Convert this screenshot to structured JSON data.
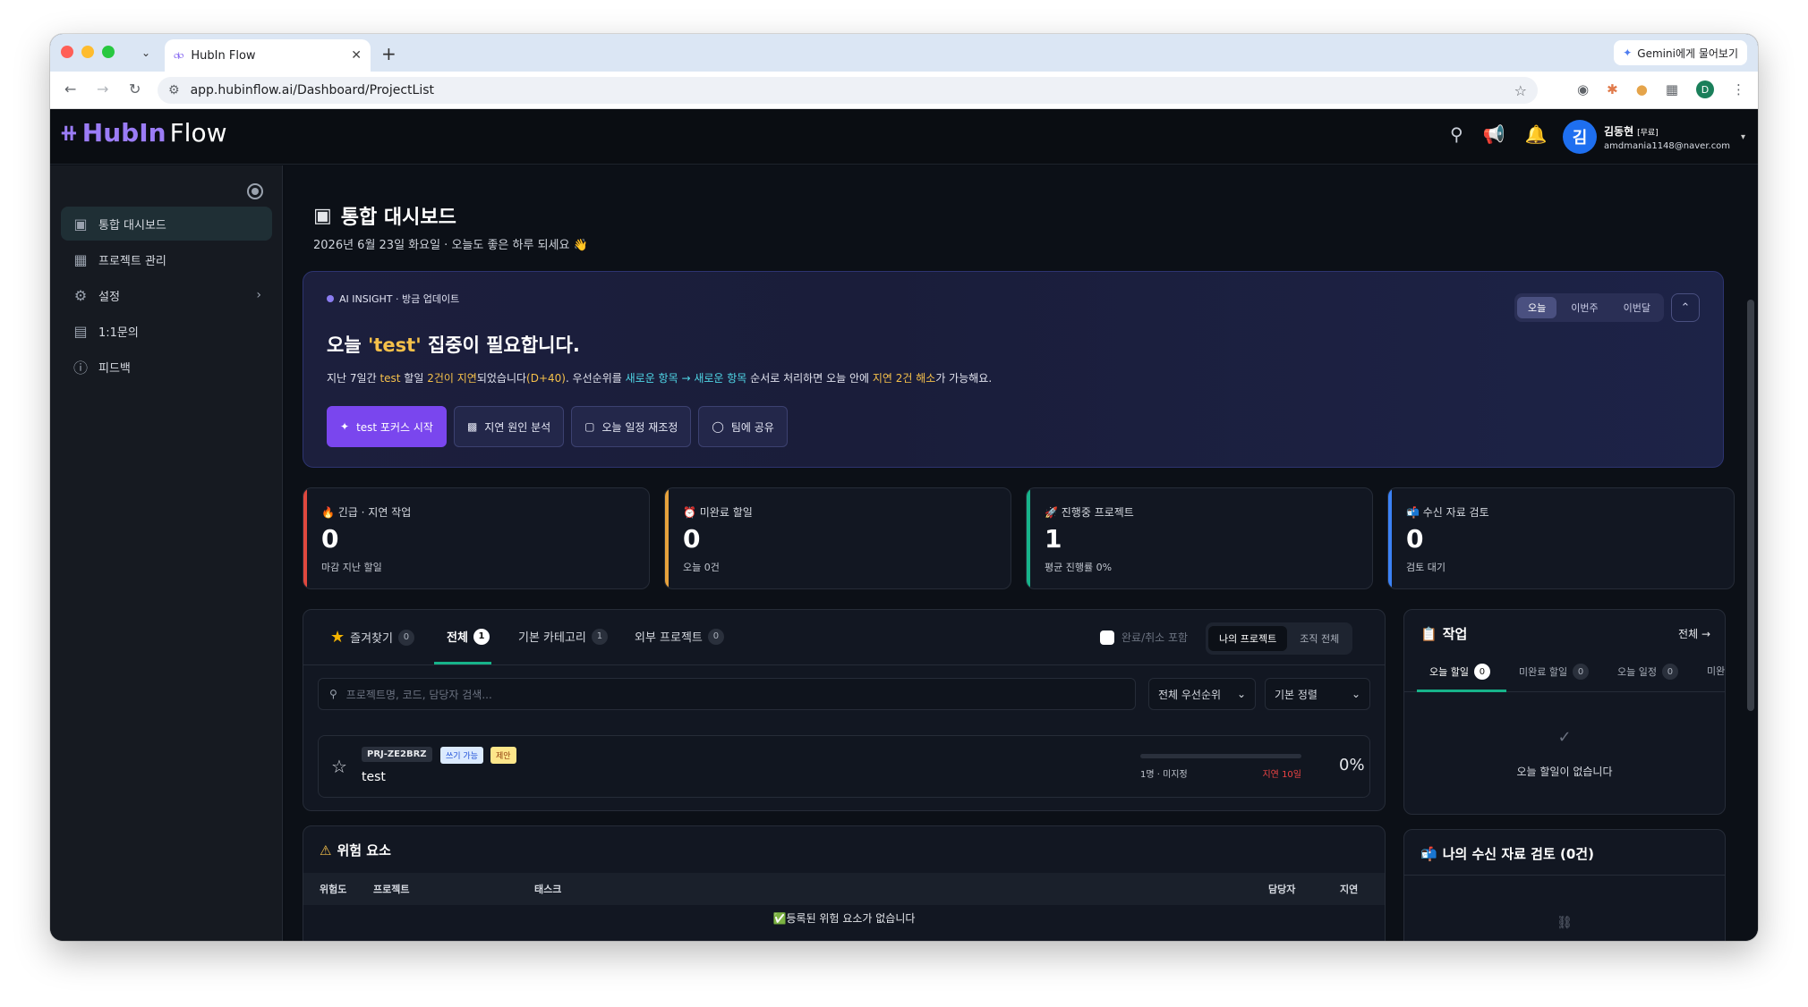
{
  "browser": {
    "tab_title": "HubIn Flow",
    "url": "app.hubinflow.ai/Dashboard/ProjectList",
    "gemini_label": "Gemini에게 물어보기",
    "profile_initial": "D"
  },
  "header": {
    "logo_hub": "HubIn",
    "logo_flow": "Flow",
    "user_initial": "김",
    "user_name": "김동현",
    "user_plan": "[무료]",
    "user_email": "amdmania1148@naver.com"
  },
  "sidebar": {
    "items": [
      {
        "label": "통합 대시보드",
        "icon": "dashboard-icon"
      },
      {
        "label": "프로젝트 관리",
        "icon": "kanban-icon"
      },
      {
        "label": "설정",
        "icon": "gear-icon"
      },
      {
        "label": "1:1문의",
        "icon": "chat-icon"
      },
      {
        "label": "피드백",
        "icon": "info-icon"
      }
    ]
  },
  "page": {
    "title": "통합 대시보드",
    "subtitle": "2026년 6월 23일 화요일 · 오늘도 좋은 하루 되세요 👋"
  },
  "insight": {
    "badge": "AI INSIGHT · 방금 업데이트",
    "periods": [
      "오늘",
      "이번주",
      "이번달"
    ],
    "headline_pre": "오늘 ",
    "headline_hl": "'test'",
    "headline_post": " 집중이 필요합니다.",
    "desc": {
      "p1": "지난 7일간 ",
      "p2": "test",
      "p3": " 할일 ",
      "p4": "2건이 지연",
      "p5": "되었습니다",
      "p6": "(D+40)",
      "p7": ". 우선순위를 ",
      "p8": "새로운 항목 → 새로운 항목",
      "p9": " 순서로 처리하면 오늘 안에 ",
      "p10": "지연 2건 해소",
      "p11": "가 가능해요."
    },
    "actions": [
      "test 포커스 시작",
      "지연 원인 분석",
      "오늘 일정 재조정",
      "팀에 공유"
    ]
  },
  "kpis": [
    {
      "label": "🔥 긴급 · 지연 작업",
      "value": "0",
      "sub": "마감 지난 할일",
      "color": "#e0483e"
    },
    {
      "label": "⏰ 미완료 할일",
      "value": "0",
      "sub": "오늘 0건",
      "color": "#e6a23c"
    },
    {
      "label": "🚀 진행중 프로젝트",
      "value": "1",
      "sub": "평균 진행률 0%",
      "color": "#17b38a"
    },
    {
      "label": "📬 수신 자료 검토",
      "value": "0",
      "sub": "검토 대기",
      "color": "#3b82f6"
    }
  ],
  "projects": {
    "tabs": [
      {
        "label": "즐겨찾기",
        "count": "0"
      },
      {
        "label": "전체",
        "count": "1"
      },
      {
        "label": "기본 카테고리",
        "count": "1"
      },
      {
        "label": "외부 프로젝트",
        "count": "0"
      }
    ],
    "include_done_label": "완료/취소 포함",
    "scope": [
      "나의 프로젝트",
      "조직 전체"
    ],
    "search_placeholder": "프로젝트명, 코드, 담당자 검색...",
    "priority_select": "전체 우선순위",
    "sort_select": "기본 정렬",
    "row": {
      "code": "PRJ-ZE2BRZ",
      "tag_write": "쓰기 가능",
      "tag_propose": "제안",
      "name": "test",
      "meta_left": "1명 · 미지정",
      "meta_right": "지연 10일",
      "progress": "0%",
      "progress_value": 0
    }
  },
  "risk": {
    "title": "위험 요소",
    "columns": [
      "위험도",
      "프로젝트",
      "태스크",
      "담당자",
      "지연"
    ],
    "empty": "등록된 위험 요소가 없습니다"
  },
  "tasks": {
    "title": "작업",
    "all_link": "전체 →",
    "tabs": [
      {
        "label": "오늘 할일",
        "count": "0"
      },
      {
        "label": "미완료 할일",
        "count": "0"
      },
      {
        "label": "오늘 일정",
        "count": "0"
      },
      {
        "label": "미완",
        "count": ""
      }
    ],
    "empty": "오늘 할일이 없습니다"
  },
  "received": {
    "title": "나의 수신 자료 검토 (0건)"
  }
}
